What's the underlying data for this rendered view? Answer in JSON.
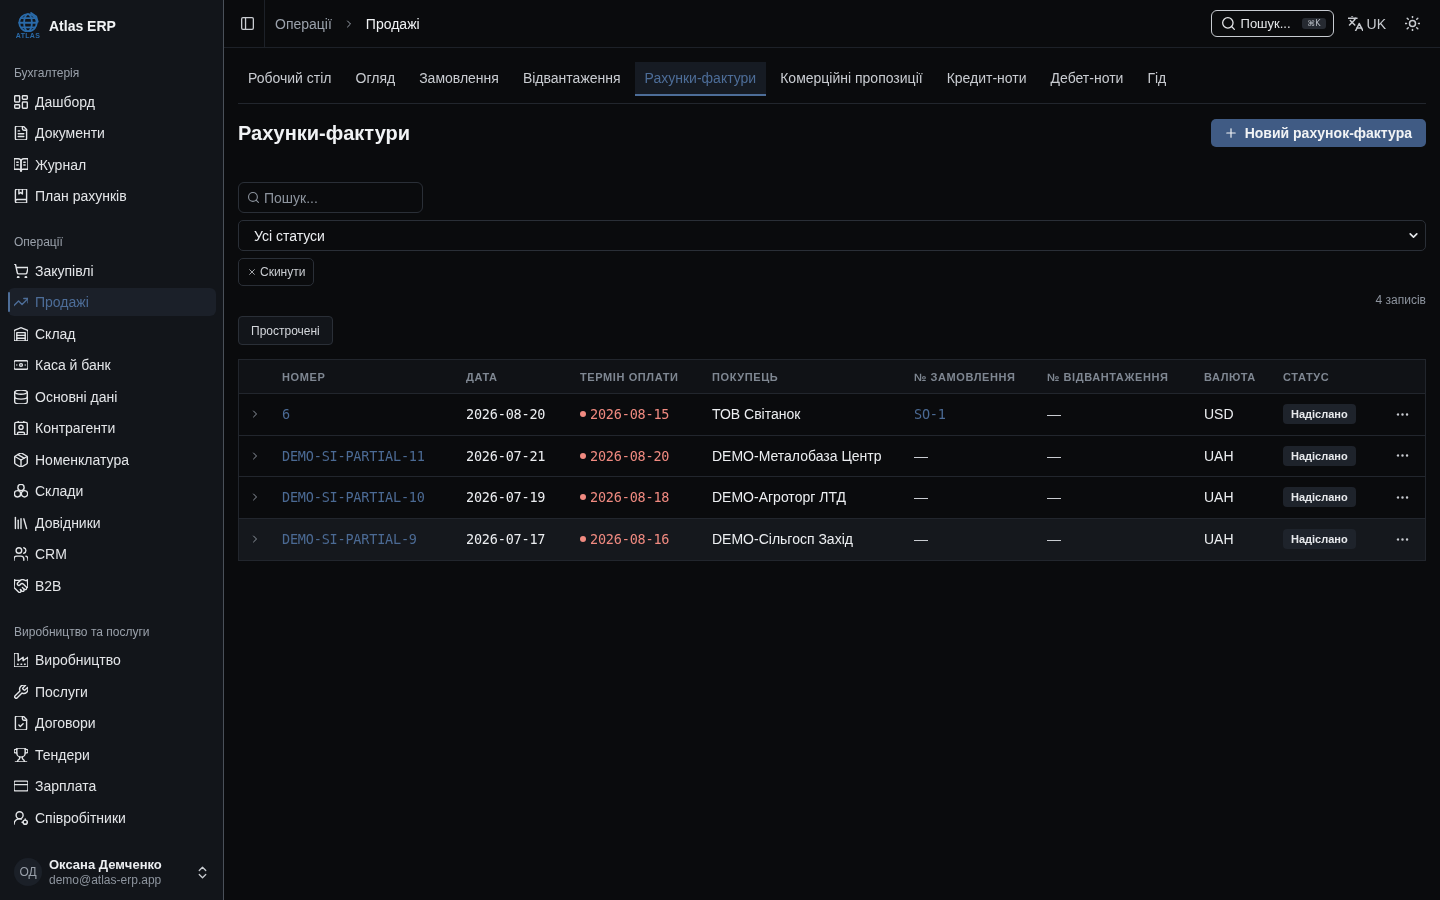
{
  "app": {
    "logo_text": "ATLAS",
    "name": "Atlas ERP"
  },
  "sidebar": {
    "sections": [
      {
        "title": "Бухгалтерія",
        "items": [
          {
            "label": "Дашборд",
            "selected": false
          },
          {
            "label": "Документи",
            "selected": false
          },
          {
            "label": "Журнал",
            "selected": false
          },
          {
            "label": "План рахунків",
            "selected": false
          }
        ]
      },
      {
        "title": "Операції",
        "items": [
          {
            "label": "Закупівлі",
            "selected": false
          },
          {
            "label": "Продажі",
            "selected": true
          },
          {
            "label": "Склад",
            "selected": false
          },
          {
            "label": "Каса й банк",
            "selected": false
          },
          {
            "label": "Основні дані",
            "selected": false
          },
          {
            "label": "Контрагенти",
            "selected": false
          },
          {
            "label": "Номенклатура",
            "selected": false
          },
          {
            "label": "Склади",
            "selected": false
          },
          {
            "label": "Довідники",
            "selected": false
          },
          {
            "label": "CRM",
            "selected": false
          },
          {
            "label": "B2B",
            "selected": false
          }
        ]
      },
      {
        "title": "Виробництво та послуги",
        "items": [
          {
            "label": "Виробництво",
            "selected": false
          },
          {
            "label": "Послуги",
            "selected": false
          },
          {
            "label": "Договори",
            "selected": false
          },
          {
            "label": "Тендери",
            "selected": false
          },
          {
            "label": "Зарплата",
            "selected": false
          },
          {
            "label": "Співробітники",
            "selected": false
          }
        ]
      }
    ]
  },
  "user": {
    "initials": "ОД",
    "name": "Оксана Демченко",
    "email": "demo@atlas-erp.app"
  },
  "topbar": {
    "breadcrumb": [
      {
        "label": "Операції",
        "current": false
      },
      {
        "label": "Продажі",
        "current": true
      }
    ],
    "search": {
      "label": "Пошук...",
      "shortcut": "⌘K"
    },
    "language": "UK"
  },
  "tabs": [
    {
      "label": "Робочий стіл",
      "selected": false
    },
    {
      "label": "Огляд",
      "selected": false
    },
    {
      "label": "Замовлення",
      "selected": false
    },
    {
      "label": "Відвантаження",
      "selected": false
    },
    {
      "label": "Рахунки-фактури",
      "selected": true
    },
    {
      "label": "Комерційні пропозиції",
      "selected": false
    },
    {
      "label": "Кредит-ноти",
      "selected": false
    },
    {
      "label": "Дебет-ноти",
      "selected": false
    },
    {
      "label": "Гід",
      "selected": false
    }
  ],
  "page": {
    "title": "Рахунки-фактури",
    "new_button": "Новий рахунок-фактура"
  },
  "filters": {
    "search": {
      "placeholder": "Пошук..."
    },
    "status": {
      "value": "Усі статуси"
    },
    "reset_button": "Скинути",
    "record_count": "4 записів",
    "quick_filters": [
      {
        "label": "Прострочені",
        "selected": false
      }
    ]
  },
  "table": {
    "columns": [
      "НОМЕР",
      "ДАТА",
      "ТЕРМІН ОПЛАТИ",
      "ПОКУПЕЦЬ",
      "№ ЗАМОВЛЕННЯ",
      "№ ВІДВАНТАЖЕННЯ",
      "ВАЛЮТА",
      "СТАТУС"
    ],
    "rows": [
      {
        "number": "6",
        "date": "2026-08-20",
        "due_date": "2026-08-15",
        "overdue": true,
        "buyer": "ТОВ Світанок",
        "order": "SO-1",
        "order_link": true,
        "shipment": "—",
        "currency": "USD",
        "status": "Надіслано",
        "highlighted": false
      },
      {
        "number": "DEMO-SI-PARTIAL-11",
        "date": "2026-07-21",
        "due_date": "2026-08-20",
        "overdue": true,
        "buyer": "DEMO-Металобаза Центр",
        "order": "—",
        "order_link": false,
        "shipment": "—",
        "currency": "UAH",
        "status": "Надіслано",
        "highlighted": false
      },
      {
        "number": "DEMO-SI-PARTIAL-10",
        "date": "2026-07-19",
        "due_date": "2026-08-18",
        "overdue": true,
        "buyer": "DEMO-Агроторг ЛТД",
        "order": "—",
        "order_link": false,
        "shipment": "—",
        "currency": "UAH",
        "status": "Надіслано",
        "highlighted": false
      },
      {
        "number": "DEMO-SI-PARTIAL-9",
        "date": "2026-07-17",
        "due_date": "2026-08-16",
        "overdue": true,
        "buyer": "DEMO-Сільгосп Захід",
        "order": "—",
        "order_link": false,
        "shipment": "—",
        "currency": "UAH",
        "status": "Надіслано",
        "highlighted": true
      }
    ]
  }
}
